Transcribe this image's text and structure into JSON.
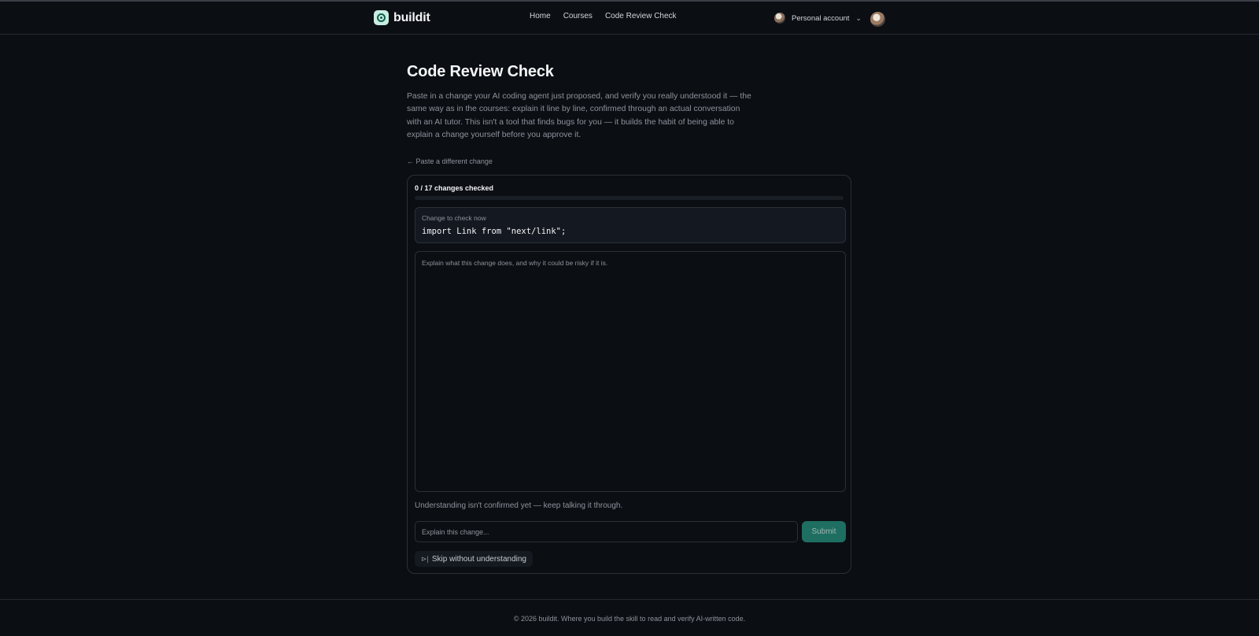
{
  "header": {
    "brand": "buildit",
    "nav": [
      "Home",
      "Courses",
      "Code Review Check"
    ],
    "account_label": "Personal account",
    "chevron": "⌄"
  },
  "page": {
    "title": "Code Review Check",
    "intro": "Paste in a change your AI coding agent just proposed, and verify you really understood it — the same way as in the courses: explain it line by line, confirmed through an actual conversation with an AI tutor. This isn't a tool that finds bugs for you — it builds the habit of being able to explain a change yourself before you approve it.",
    "back_link": "← Paste a different change"
  },
  "review": {
    "progress_text": "0 / 17 changes checked",
    "progress_fraction": 0,
    "change_caption": "Change to check now",
    "change_code": "import Link from \"next/link\";",
    "chat_prompt": "Explain what this change does, and why it could be risky if it is.",
    "status": "Understanding isn't confirmed yet — keep talking it through.",
    "input_placeholder": "Explain this change...",
    "submit_label": "Submit",
    "skip_icon": "⊳|",
    "skip_label": "Skip without understanding"
  },
  "footer": {
    "text": "© 2026 buildit. Where you build the skill to read and verify AI-written code."
  },
  "colors": {
    "background": "#0b0e13",
    "accent": "#1e6e61",
    "logo_bg": "#c9ece1"
  }
}
